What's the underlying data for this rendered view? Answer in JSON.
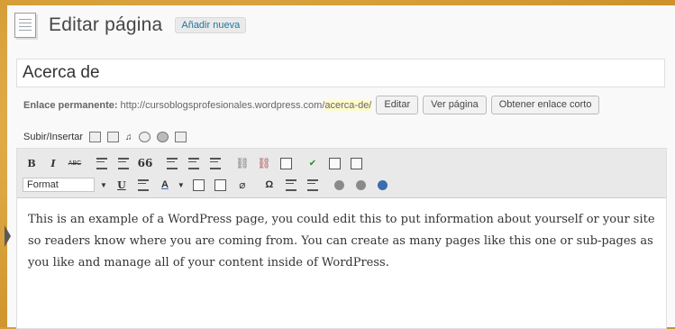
{
  "header": {
    "title": "Editar página",
    "add_new_label": "Añadir nueva"
  },
  "post": {
    "title_value": "Acerca de"
  },
  "permalink": {
    "label": "Enlace permanente:",
    "base_url": "http://cursoblogsprofesionales.wordpress.com/",
    "slug": "acerca-de/",
    "edit_label": "Editar",
    "view_label": "Ver página",
    "shortlink_label": "Obtener enlace corto"
  },
  "media": {
    "label": "Subir/Insertar",
    "icons": [
      "image-icon",
      "gallery-icon",
      "audio-icon",
      "video-icon",
      "cd-icon",
      "media-library-icon"
    ]
  },
  "toolbar": {
    "row1": [
      "bold-icon",
      "italic-icon",
      "strikethrough-icon",
      "bullet-list-icon",
      "numbered-list-icon",
      "blockquote-icon",
      "align-left-icon",
      "align-center-icon",
      "align-right-icon",
      "link-icon",
      "unlink-icon",
      "more-tag-icon",
      "spellcheck-icon",
      "fullscreen-icon",
      "kitchen-sink-icon"
    ],
    "row2_format_label": "Format",
    "row2": [
      "underline-icon",
      "justify-icon",
      "text-color-icon",
      "paste-text-icon",
      "paste-word-icon",
      "clear-format-icon",
      "special-char-icon",
      "outdent-icon",
      "indent-icon",
      "undo-icon",
      "redo-icon",
      "help-icon"
    ],
    "glyphs": {
      "bold": "B",
      "italic": "I",
      "strike": "ABC",
      "quote": "66",
      "underline": "U",
      "textcolor": "A",
      "omega": "Ω"
    }
  },
  "content": {
    "paragraph": "This is an example of a WordPress page, you could edit this to put information about yourself or your site so readers know where you are coming from. You can create as many pages like this one or sub-pages as you like and manage all of your content inside of WordPress."
  },
  "colors": {
    "accent_link": "#21759b",
    "background_gold": "#d9a23c",
    "slug_highlight": "#fffbcc"
  }
}
